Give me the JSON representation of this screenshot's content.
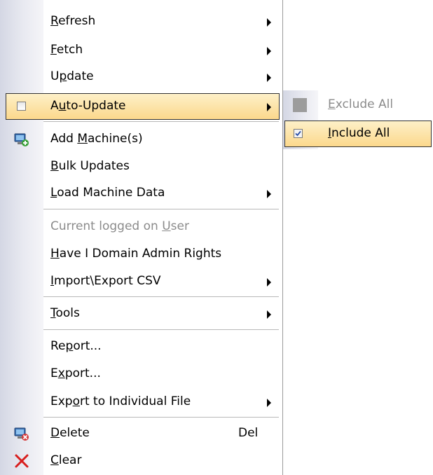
{
  "menu": {
    "items": [
      {
        "pre": "",
        "key": "R",
        "post": "efresh"
      },
      {
        "pre": "",
        "key": "F",
        "post": "etch"
      },
      {
        "pre": "U",
        "key": "p",
        "post": "date"
      },
      {
        "pre": "A",
        "key": "u",
        "post": "to-Update"
      },
      {
        "pre": "Add ",
        "key": "M",
        "post": "achine(s)"
      },
      {
        "pre": "",
        "key": "B",
        "post": "ulk Updates"
      },
      {
        "pre": "",
        "key": "L",
        "post": "oad Machine Data"
      },
      {
        "pre": "Current logged on ",
        "key": "U",
        "post": "ser"
      },
      {
        "pre": "",
        "key": "H",
        "post": "ave I Domain Admin Rights"
      },
      {
        "pre": "",
        "key": "I",
        "post": "mport\\Export CSV"
      },
      {
        "pre": "",
        "key": "T",
        "post": "ools"
      },
      {
        "pre": "Re",
        "key": "p",
        "post": "ort..."
      },
      {
        "pre": "E",
        "key": "x",
        "post": "port..."
      },
      {
        "pre": "Exp",
        "key": "o",
        "post": "rt to Individual File"
      },
      {
        "pre": "",
        "key": "D",
        "post": "elete"
      },
      {
        "pre": "",
        "key": "C",
        "post": "lear"
      }
    ],
    "delete_shortcut": "Del"
  },
  "submenu": {
    "items": [
      {
        "pre": "",
        "key": "E",
        "post": "xclude All"
      },
      {
        "pre": "",
        "key": "I",
        "post": "nclude All"
      }
    ]
  },
  "colors": {
    "highlight_top": "#fdf0c8",
    "highlight_bottom": "#fcd88c",
    "disabled_text": "#8b8b8b",
    "separator": "#b8b8b8"
  },
  "icons": {
    "add_machine": "computer-add-icon",
    "delete": "computer-delete-icon",
    "clear": "red-x-icon"
  }
}
